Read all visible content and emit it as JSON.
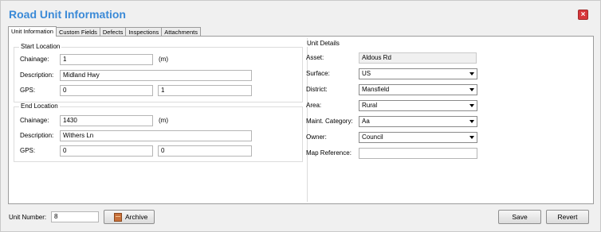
{
  "window": {
    "title": "Road Unit Information",
    "close_symbol": "×"
  },
  "tabs": [
    {
      "label": "Unit Information",
      "active": true
    },
    {
      "label": "Custom Fields"
    },
    {
      "label": "Defects"
    },
    {
      "label": "Inspections"
    },
    {
      "label": "Attachments"
    }
  ],
  "start_location": {
    "title": "Start Location",
    "chainage_label": "Chainage:",
    "chainage_value": "1",
    "chainage_unit": "(m)",
    "description_label": "Description:",
    "description_value": "Midland Hwy",
    "gps_label": "GPS:",
    "gps_x": "0",
    "gps_y": "1"
  },
  "end_location": {
    "title": "End Location",
    "chainage_label": "Chainage:",
    "chainage_value": "1430",
    "chainage_unit": "(m)",
    "description_label": "Description:",
    "description_value": "Withers Ln",
    "gps_label": "GPS:",
    "gps_x": "0",
    "gps_y": "0"
  },
  "unit_details": {
    "title": "Unit Details",
    "asset_label": "Asset:",
    "asset_value": "Aldous Rd",
    "surface_label": "Surface:",
    "surface_value": "US",
    "district_label": "District:",
    "district_value": "Mansfield",
    "area_label": "Area:",
    "area_value": "Rural",
    "maint_label": "Maint. Category:",
    "maint_value": "Aa",
    "owner_label": "Owner:",
    "owner_value": "Council",
    "mapref_label": "Map Reference:",
    "mapref_value": ""
  },
  "footer": {
    "unit_number_label": "Unit Number:",
    "unit_number_value": "8",
    "archive_label": "Archive",
    "save_label": "Save",
    "revert_label": "Revert"
  },
  "colors": {
    "title": "#3b8ad7",
    "close": "#d7363b"
  }
}
